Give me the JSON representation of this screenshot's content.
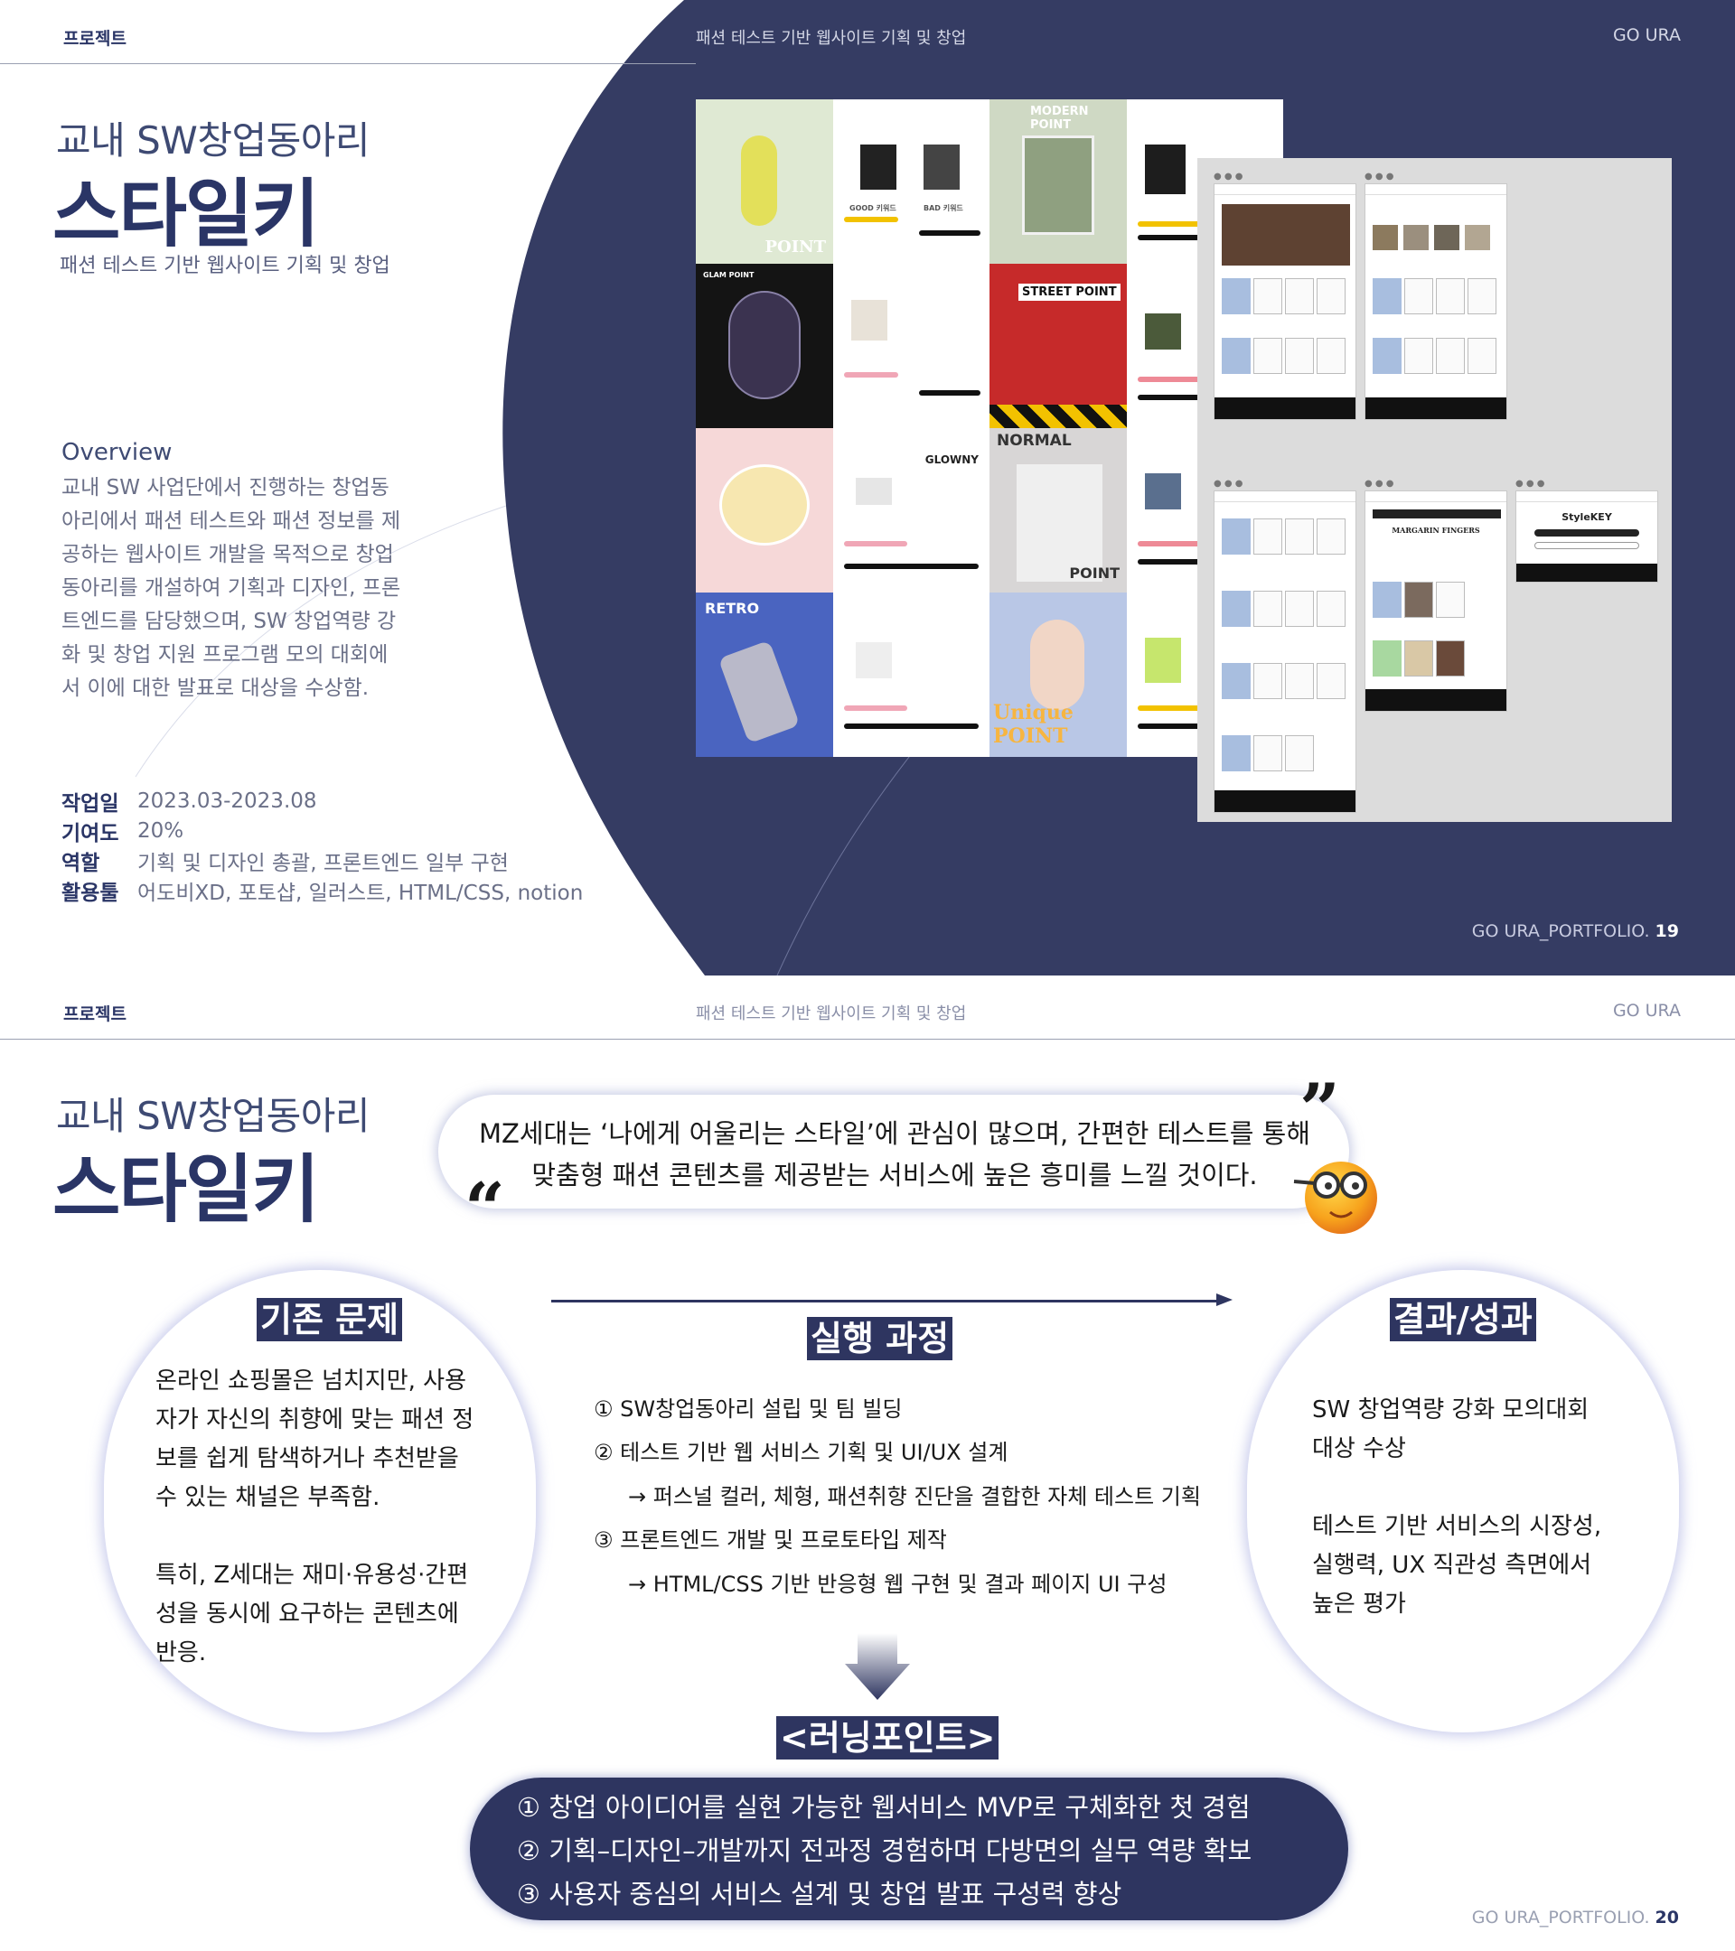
{
  "page1": {
    "header": {
      "tag": "프로젝트",
      "center": "패션 테스트 기반 웹사이트 기획 및 창업",
      "right": "GO URA"
    },
    "subtitle": "교내 SW창업동아리",
    "title": "스타일키",
    "tagline": "패션 테스트 기반 웹사이트 기획 및 창업",
    "overview": {
      "heading": "Overview",
      "lines": [
        "교내 SW 사업단에서 진행하는 창업동",
        "아리에서 패션 테스트와 패션 정보를 제",
        "공하는 웹사이트 개발을 목적으로 창업",
        "동아리를 개설하여 기획과 디자인, 프론",
        "트엔드를 담당했으며, SW 창업역량 강",
        "화 및 창업 지원 프로그램 모의 대회에",
        "서 이에 대한 발표로 대상을 수상함."
      ]
    },
    "meta": [
      {
        "key": "작업일",
        "value": "2023.03-2023.08"
      },
      {
        "key": "기여도",
        "value": "20%"
      },
      {
        "key": "역할",
        "value": "기획 및 디자인 총괄, 프론트엔드 일부 구현"
      },
      {
        "key": "활용툴",
        "value": "어도비XD, 포토샵, 일러스트, HTML/CSS, notion"
      }
    ],
    "footer": {
      "text": "GO URA_PORTFOLIO.",
      "page": "19"
    },
    "collage_labels": [
      "POINT",
      "GLAM POINT",
      "MODERN POINT",
      "STREET POINT",
      "NORMAL",
      "POINT",
      "GLOWNY",
      "RETRO",
      "Unique POINT",
      "GOOD 키워드",
      "BAD 키워드"
    ],
    "mockup_labels": {
      "brand": "StyleKEY",
      "margarin": "MARGARIN FINGERS"
    }
  },
  "page2": {
    "header": {
      "tag": "프로젝트",
      "center": "패션 테스트 기반 웹사이트 기획 및 창업",
      "right": "GO URA"
    },
    "subtitle": "교내 SW창업동아리",
    "title": "스타일키",
    "quote": {
      "line1": "MZ세대는 ‘나에게 어울리는 스타일’에 관심이 많으며, 간편한 테스트를 통해",
      "line2": "맞춤형 패션 콘텐츠를 제공받는 서비스에 높은 흥미를 느낄 것이다."
    },
    "problem": {
      "title": "기존 문제",
      "lines": [
        "온라인 쇼핑몰은 넘치지만, 사용",
        "자가 자신의 취향에 맞는 패션 정",
        "보를 쉽게 탐색하거나 추천받을",
        "수 있는 채널은 부족함.",
        "",
        "특히, Z세대는 재미·유용성·간편",
        "성을 동시에 요구하는 콘텐츠에",
        "반응."
      ]
    },
    "process": {
      "title": "실행 과정",
      "steps": [
        "① SW창업동아리 설립 및 팀 빌딩",
        "② 테스트 기반 웹 서비스 기획 및 UI/UX 설계",
        "→ 퍼스널 컬러, 체형, 패션취향 진단을 결합한 자체 테스트 기획",
        "③ 프론트엔드 개발 및 프로토타입 제작",
        "→ HTML/CSS 기반 반응형 웹 구현 및 결과 페이지 UI 구성"
      ]
    },
    "result": {
      "title": "결과/성과",
      "lines": [
        "SW 창업역량 강화 모의대회",
        "대상 수상",
        "",
        "테스트 기반 서비스의 시장성,",
        "실행력, UX 직관성 측면에서",
        "높은 평가"
      ]
    },
    "learning": {
      "title": "<러닝포인트>",
      "lines": [
        "① 창업 아이디어를 실현 가능한 웹서비스 MVP로 구체화한 첫 경험",
        "② 기획–디자인–개발까지 전과정 경험하며 다방면의 실무 역량 확보",
        "③ 사용자 중심의 서비스 설계 및 창업 발표 구성력 향상"
      ]
    },
    "footer": {
      "text": "GO URA_PORTFOLIO.",
      "page": "20"
    }
  },
  "colors": {
    "navy": "#353c63",
    "badge": "#2e3560",
    "title": "#2a3566"
  },
  "icons": [
    "open-quote-icon",
    "close-quote-icon",
    "nerd-emoji-icon",
    "down-arrow-icon",
    "right-arrow-icon"
  ]
}
